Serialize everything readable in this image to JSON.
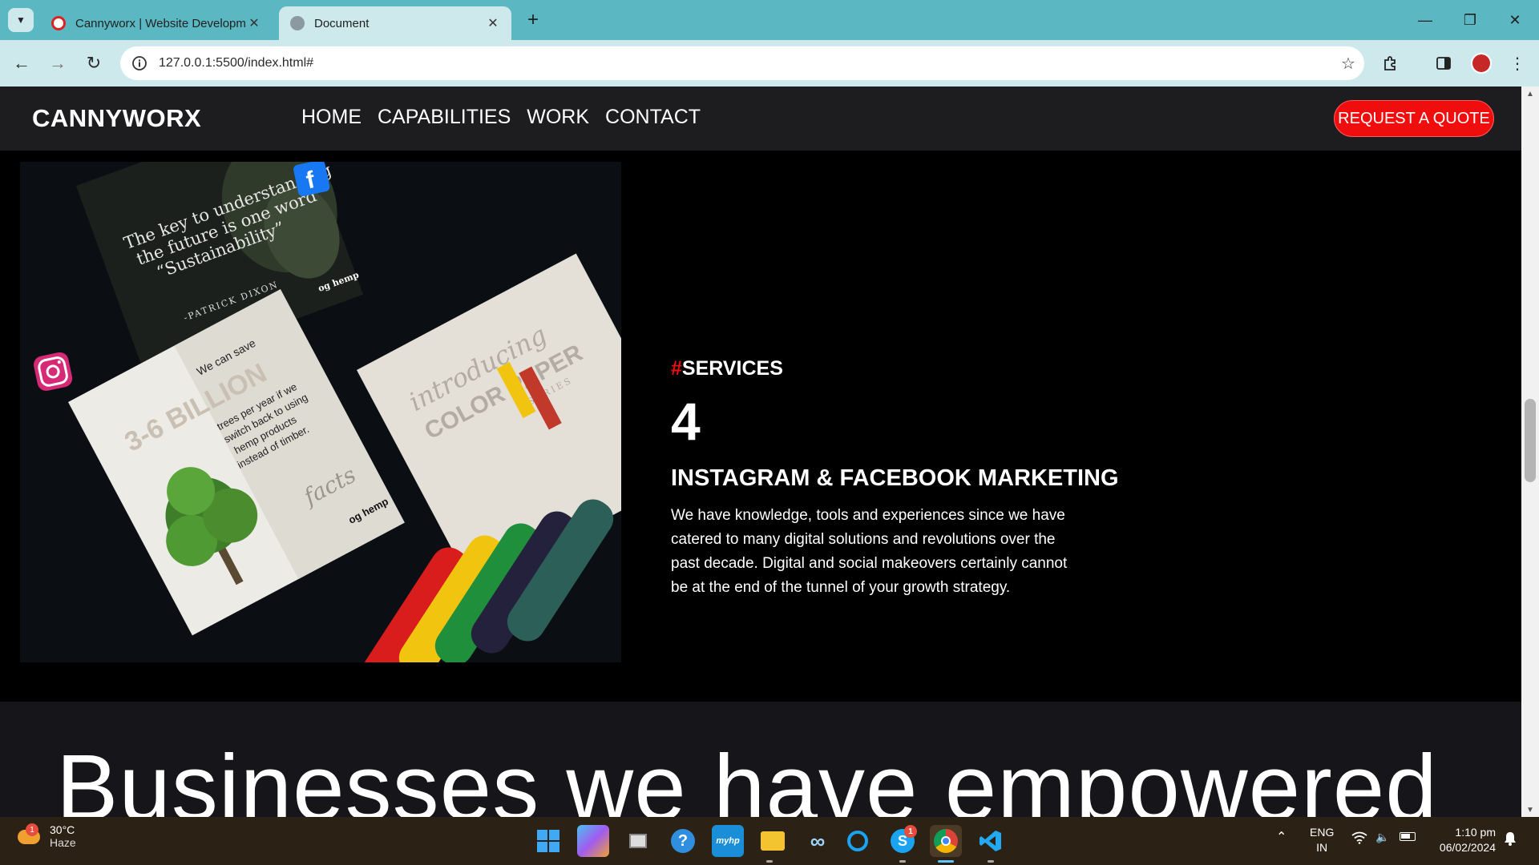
{
  "browser": {
    "tabs": [
      {
        "title": "Cannyworx | Website Developm",
        "active": false
      },
      {
        "title": "Document",
        "active": true
      }
    ],
    "new_tab_icon": "plus-icon",
    "url": "127.0.0.1:5500/index.html#"
  },
  "site": {
    "logo": "CANNYWORX",
    "nav": [
      "HOME",
      "CAPABILITIES",
      "WORK",
      "CONTACT"
    ],
    "quote_button": "REQUEST A QUOTE"
  },
  "service": {
    "tag_hash": "#",
    "tag_label": "SERVICES",
    "number": "4",
    "title": "INSTAGRAM & FACEBOOK MARKETING",
    "description": "We have knowledge, tools and experiences since we have catered to many digital solutions and revolutions over the past decade. Digital and social makeovers certainly cannot be at the end of the tunnel of your growth strategy.",
    "image": {
      "quote": "The key to understanding the future is one word “Sustainability”",
      "quote_author": "-PATRICK DIXON",
      "brand_small": "og hemp",
      "stat_pre": "We can save",
      "stat_big": "3-6 BILLION",
      "stat_post": "trees per year if we switch back to using hemp products instead of timber.",
      "facts": "facts",
      "intro_script": "introducing",
      "color_paper": "COLOR PAPER",
      "series": "SERIES"
    }
  },
  "businesses": {
    "heading": "Businesses we have empowered"
  },
  "taskbar": {
    "weather_temp": "30°C",
    "weather_cond": "Haze",
    "weather_badge": "1",
    "skype_badge": "1",
    "lang_top": "ENG",
    "lang_bottom": "IN",
    "time": "1:10 pm",
    "date": "06/02/2024"
  },
  "colors": {
    "accent_red": "#f00d0d",
    "header_bg": "#1d1d20",
    "chrome_teal": "#5bb8c2",
    "chrome_light": "#cde9ec"
  }
}
